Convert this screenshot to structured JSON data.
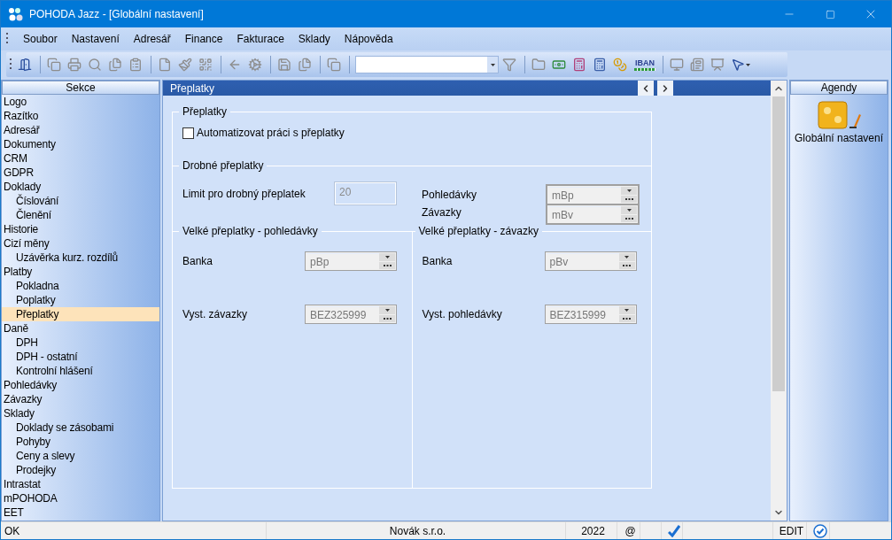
{
  "window": {
    "title": "POHODA Jazz - [Globální nastavení]"
  },
  "menu": [
    {
      "label": "Soubor"
    },
    {
      "label": "Nastavení"
    },
    {
      "label": "Adresář"
    },
    {
      "label": "Finance"
    },
    {
      "label": "Fakturace"
    },
    {
      "label": "Sklady"
    },
    {
      "label": "Nápověda"
    }
  ],
  "toolbar": {
    "iban_label": "IBAN"
  },
  "sidebar": {
    "title": "Sekce",
    "items": [
      {
        "label": "Logo",
        "selected": false
      },
      {
        "label": "Razítko",
        "selected": false
      },
      {
        "label": "Adresář",
        "selected": false
      },
      {
        "label": "Dokumenty",
        "selected": false
      },
      {
        "label": "CRM",
        "selected": false
      },
      {
        "label": "GDPR",
        "selected": false
      },
      {
        "label": "Doklady",
        "selected": false,
        "children": [
          {
            "label": "Číslování",
            "selected": false
          },
          {
            "label": "Členění",
            "selected": false
          }
        ]
      },
      {
        "label": "Historie",
        "selected": false
      },
      {
        "label": "Cizí měny",
        "selected": false,
        "children": [
          {
            "label": "Uzávěrka kurz. rozdílů",
            "selected": false
          }
        ]
      },
      {
        "label": "Platby",
        "selected": false,
        "children": [
          {
            "label": "Pokladna",
            "selected": false
          },
          {
            "label": "Poplatky",
            "selected": false
          },
          {
            "label": "Přeplatky",
            "selected": true
          }
        ]
      },
      {
        "label": "Daně",
        "selected": false,
        "children": [
          {
            "label": "DPH",
            "selected": false
          },
          {
            "label": "DPH - ostatní",
            "selected": false
          },
          {
            "label": "Kontrolní hlášení",
            "selected": false
          }
        ]
      },
      {
        "label": "Pohledávky",
        "selected": false
      },
      {
        "label": "Závazky",
        "selected": false
      },
      {
        "label": "Sklady",
        "selected": false,
        "children": [
          {
            "label": "Doklady se zásobami",
            "selected": false
          },
          {
            "label": "Pohyby",
            "selected": false
          },
          {
            "label": "Ceny a slevy",
            "selected": false
          },
          {
            "label": "Prodejky",
            "selected": false
          }
        ]
      },
      {
        "label": "Intrastat",
        "selected": false
      },
      {
        "label": "mPOHODA",
        "selected": false
      },
      {
        "label": "EET",
        "selected": false
      }
    ]
  },
  "panel": {
    "title": "Přeplatky",
    "section_overpayments": {
      "legend": "Přeplatky",
      "checkbox": {
        "label": "Automatizovat práci s přeplatky",
        "checked": false
      }
    },
    "section_small": {
      "legend": "Drobné přeplatky",
      "limit": {
        "label": "Limit pro drobný přeplatek",
        "value": "20",
        "disabled": true
      },
      "receivables": {
        "label": "Pohledávky",
        "value": "mBp",
        "disabled": true
      },
      "payables": {
        "label": "Závazky",
        "value": "mBv",
        "disabled": true
      }
    },
    "section_large_receivables": {
      "legend": "Velké přeplatky - pohledávky",
      "fields": [
        {
          "label": "Banka",
          "value": "pBp",
          "disabled": true
        },
        {
          "label": "Vyst. závazky",
          "value": "BEZ325999",
          "disabled": true
        }
      ]
    },
    "section_large_payables": {
      "legend": "Velké přeplatky - závazky",
      "fields": [
        {
          "label": "Banka",
          "value": "pBv",
          "disabled": true
        },
        {
          "label": "Vyst. pohledávky",
          "value": "BEZ315999",
          "disabled": true
        }
      ]
    }
  },
  "agendas": {
    "title": "Agendy",
    "items": [
      {
        "label": "Globální nastavení"
      }
    ]
  },
  "status_bar": {
    "message": "OK",
    "company": "Novák s.r.o.",
    "year": "2022",
    "email": "@",
    "mode": "EDIT"
  }
}
